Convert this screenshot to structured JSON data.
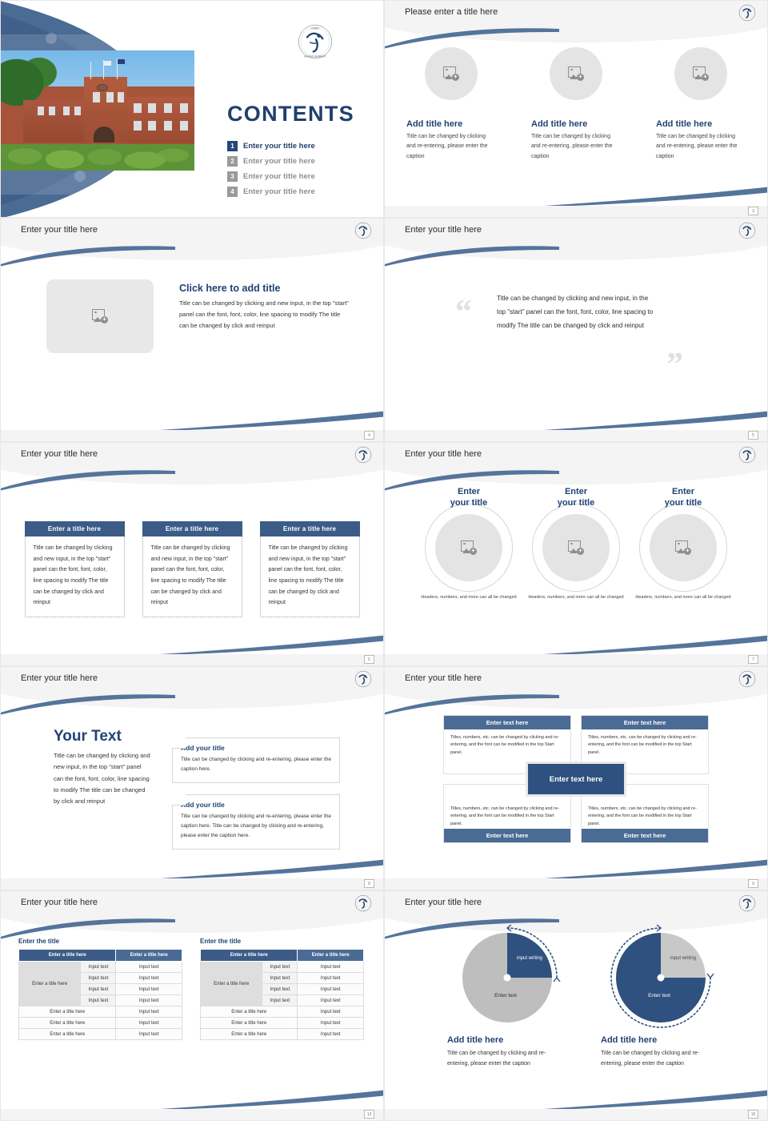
{
  "brand": {
    "navy": "#1f4274",
    "steel": "#3c5c87",
    "slate": "#4a6b94",
    "deep": "#2f5180",
    "gray": "#dedede"
  },
  "logo": {
    "name": "university-emblem"
  },
  "title_slide": {
    "heading": "CONTENTS",
    "items": [
      {
        "num": "1",
        "label": "Enter your title here",
        "active": true
      },
      {
        "num": "2",
        "label": "Enter your title here",
        "active": false
      },
      {
        "num": "3",
        "label": "Enter your title here",
        "active": false
      },
      {
        "num": "4",
        "label": "Enter your title here",
        "active": false
      }
    ],
    "photo_alt": "campus-building-photo"
  },
  "slide2": {
    "title": "Please enter a title here",
    "page": "3",
    "columns": [
      {
        "title": "Add title here",
        "desc": "Title can be changed by clicking and re-entering, please enter the caption"
      },
      {
        "title": "Add title here",
        "desc": "Title can be changed by clicking and re-entering, please enter the caption"
      },
      {
        "title": "Add title here",
        "desc": "Title can be changed by clicking and re-entering, please enter the caption"
      }
    ]
  },
  "slide3": {
    "title": "Enter your title here",
    "page": "4",
    "heading": "Click here to add title",
    "desc": "Title can be changed by clicking and new input, in the top \"start\" panel can the font, font, color, line spacing to modify The title can be changed by click and reinput"
  },
  "slide4": {
    "title": "Enter your title here",
    "page": "5",
    "quote_open": "“",
    "quote_close": "”",
    "text": "Title can be changed by clicking and new input, in the top \"start\" panel can the font, font, color, line spacing to modify The title can be changed by click and reinput"
  },
  "slide5": {
    "title": "Enter your title here",
    "page": "6",
    "columns": [
      {
        "head": "Enter a title here",
        "body": "Title can be changed by clicking and new input, in the top \"start\" panel can the font, font, color, line spacing to modify The title can be changed by click and reinput"
      },
      {
        "head": "Enter a title here",
        "body": "Title can be changed by clicking and new input, in the top \"start\" panel can the font, font, color, line spacing to modify The title can be changed by click and reinput"
      },
      {
        "head": "Enter a title here",
        "body": "Title can be changed by clicking and new input, in the top \"start\" panel can the font, font, color, line spacing to modify The title can be changed by click and reinput"
      }
    ]
  },
  "slide6": {
    "title": "Enter your title here",
    "page": "7",
    "columns": [
      {
        "title": "Enter\nyour title",
        "caption": "Headers, numbers, and more can all be changed"
      },
      {
        "title": "Enter\nyour title",
        "caption": "Headers, numbers, and more can all be changed"
      },
      {
        "title": "Enter\nyour title",
        "caption": "Headers, numbers, and more can all be changed"
      }
    ]
  },
  "slide7": {
    "title": "Enter your title here",
    "page": "8",
    "big": "Your Text",
    "desc": "Title can be changed by clicking and new input, in the top \"start\" panel can the font, font, color, line spacing to modify The title can be changed by click and reinput",
    "boxes": [
      {
        "title": "Add your title",
        "desc": "Title can be changed by clicking and re-entering, please enter the caption here."
      },
      {
        "title": "Add your title",
        "desc": "Title can be changed by clicking and re-entering, please enter the caption here. Title can be changed by clicking and re-entering, please enter the caption here."
      }
    ]
  },
  "slide8": {
    "title": "Enter your title here",
    "page": "9",
    "center": "Enter text here",
    "cells": [
      {
        "bar": "Enter text here",
        "bar_pos": "top",
        "text": "Titles, numbers, etc. can be changed by clicking and re-entering, and the font can be modified in the top Start panel."
      },
      {
        "bar": "Enter text here",
        "bar_pos": "top",
        "text": "Titles, numbers, etc. can be changed by clicking and re-entering, and the font can be modified in the top Start panel."
      },
      {
        "bar": "Enter text here",
        "bar_pos": "bottom",
        "text": "Titles, numbers, etc. can be changed by clicking and re-entering, and the font can be modified in the top Start panel."
      },
      {
        "bar": "Enter text here",
        "bar_pos": "bottom",
        "text": "Titles, numbers, etc. can be changed by clicking and re-entering, and the font can be modified in the top Start panel."
      }
    ]
  },
  "slide9": {
    "title": "Enter your title here",
    "page": "13",
    "tables": [
      {
        "caption": "Enter the title",
        "headers": [
          "Enter a title here",
          "Enter a title here"
        ],
        "merged_label": "Enter a title here",
        "input_label": "Input text",
        "input_rows": 4,
        "footer_rows": [
          {
            "label": "Enter a title here",
            "value": "Input text"
          },
          {
            "label": "Enter a title here",
            "value": "Input text"
          },
          {
            "label": "Enter a title here",
            "value": "Input text"
          }
        ]
      },
      {
        "caption": "Enter the title",
        "headers": [
          "Enter a title here",
          "Enter a title here"
        ],
        "merged_label": "Enter a title here",
        "input_label": "Input text",
        "input_rows": 4,
        "footer_rows": [
          {
            "label": "Enter a title here",
            "value": "Input text"
          },
          {
            "label": "Enter a title here",
            "value": "Input text"
          },
          {
            "label": "Enter a title here",
            "value": "Input text"
          }
        ]
      }
    ]
  },
  "slide10": {
    "title": "Enter your title here",
    "page": "15",
    "charts": [
      {
        "label_small": "input writing",
        "label_big": "Enter text",
        "title": "Add title here",
        "desc": "Title can be changed by clicking and re-entering, please enter the caption"
      },
      {
        "label_small": "input writing",
        "label_big": "Enter text",
        "title": "Add title here",
        "desc": "Title can be changed by clicking and re-entering, please enter the caption"
      }
    ]
  },
  "chart_data": [
    {
      "type": "pie",
      "title": "Add title here",
      "labels": [
        "input writing",
        "Enter text"
      ],
      "values": [
        25,
        75
      ],
      "colors": [
        "#2f5180",
        "#bebebe"
      ],
      "start_angle": 0,
      "legend": "inside"
    },
    {
      "type": "pie",
      "title": "Add title here",
      "labels": [
        "input writing",
        "Enter text"
      ],
      "values": [
        25,
        75
      ],
      "colors": [
        "#c8c8c8",
        "#2f5180"
      ],
      "start_angle": 0,
      "legend": "inside"
    }
  ]
}
